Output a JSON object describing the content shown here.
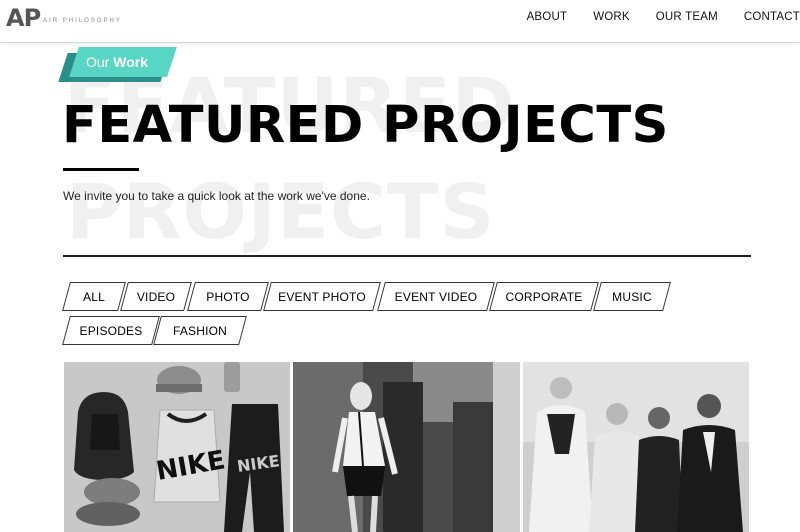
{
  "header": {
    "logo_mark": "AP",
    "logo_text": "AIR PHILOSOPHY",
    "nav": [
      "ABOUT",
      "WORK",
      "OUR TEAM",
      "CONTACT"
    ]
  },
  "hero": {
    "eyebrow_light": "Our",
    "eyebrow_bold": "Work",
    "background_words": [
      "FEATURED",
      "PROJECTS"
    ],
    "title": "FEATURED PROJECTS",
    "intro": "We invite you to take a quick look at the work we've done."
  },
  "filters": [
    "ALL",
    "VIDEO",
    "PHOTO",
    "EVENT PHOTO",
    "EVENT VIDEO",
    "CORPORATE",
    "MUSIC",
    "EPISODES",
    "FASHION"
  ],
  "gallery": [
    {
      "name": "nike-flatlay",
      "wordmark": "NIKE"
    },
    {
      "name": "fashion-model"
    },
    {
      "name": "event-group"
    }
  ],
  "colors": {
    "accent": "#58d5c5",
    "accent_dark": "#2a8f88",
    "text": "#000000",
    "ghost_text": "#f0f0f0"
  }
}
